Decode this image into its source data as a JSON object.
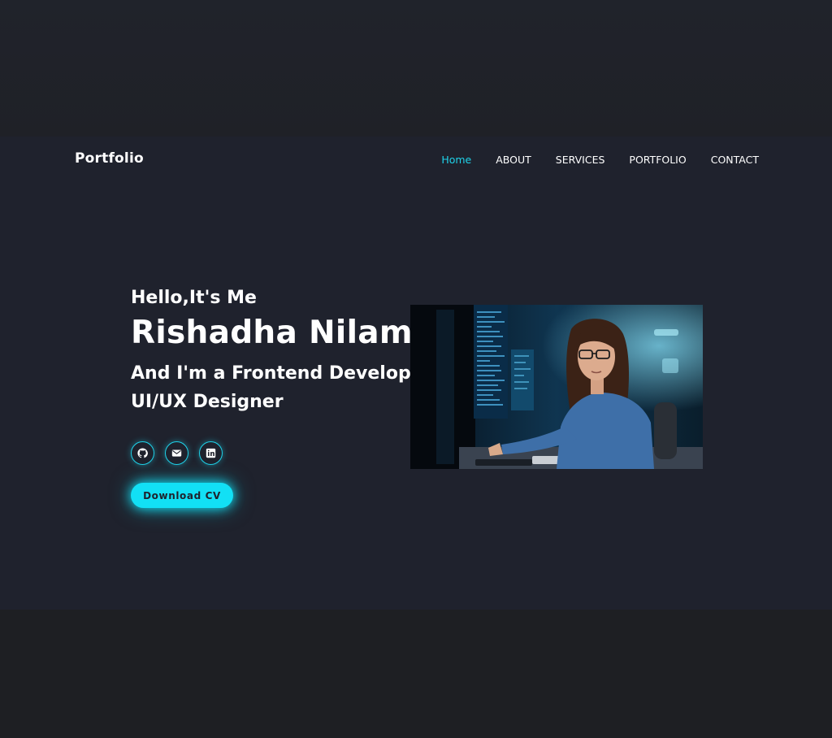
{
  "header": {
    "logo": "Portfolio",
    "nav": [
      "Home",
      "ABOUT",
      "SERVICES",
      "PORTFOLIO",
      "CONTACT"
    ],
    "active_nav": "Home"
  },
  "hero": {
    "greeting": "Hello,It's Me",
    "name": "Rishadha Nilam",
    "role_line1": "And I'm a Frontend Developer",
    "role_line2": "UI/UX Designer",
    "socials": [
      "github-icon",
      "mail-icon",
      "linkedin-icon"
    ],
    "cv_button": "Download CV"
  },
  "colors": {
    "accent": "#1fd3ea",
    "button": "#12e0f5",
    "hero_bg": "#1f222d",
    "page_bg": "#1f2025"
  }
}
